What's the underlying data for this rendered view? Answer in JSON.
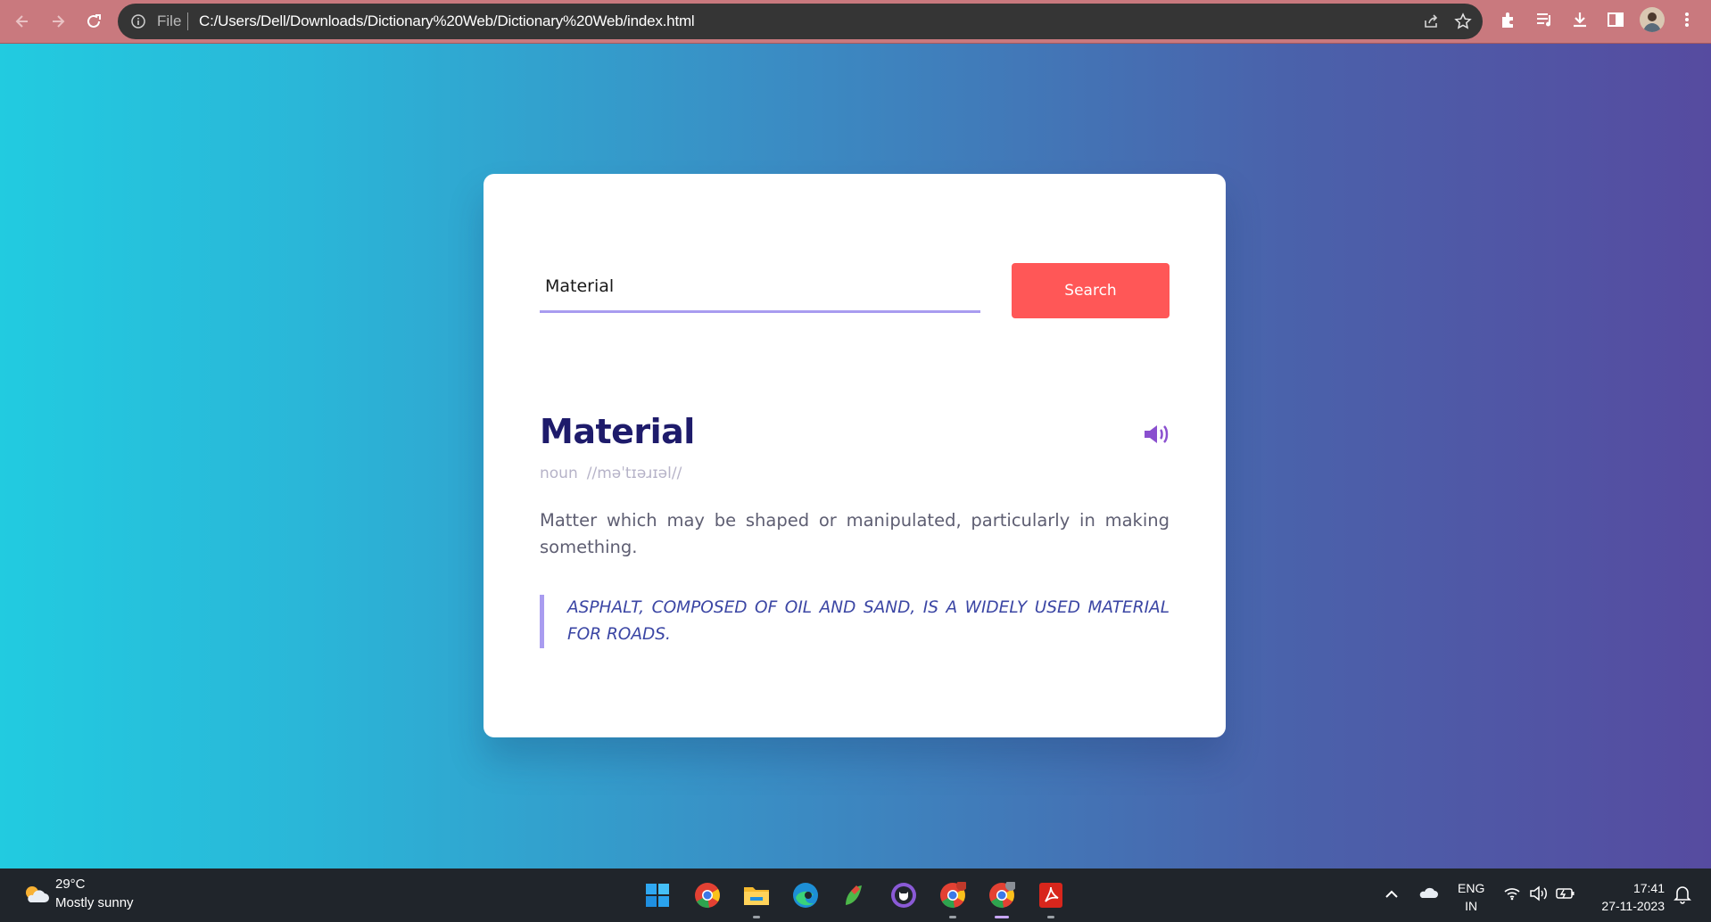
{
  "browser": {
    "file_label": "File",
    "url": "C:/Users/Dell/Downloads/Dictionary%20Web/Dictionary%20Web/index.html"
  },
  "search": {
    "value": "Material",
    "button_label": "Search"
  },
  "result": {
    "word": "Material",
    "part_of_speech": "noun",
    "pronunciation": "//məˈtɪəɹɪəl//",
    "meaning": "Matter which may be shaped or manipulated, particularly in making something.",
    "example": "Asphalt, composed of oil and sand, is a widely used material for roads."
  },
  "taskbar": {
    "weather_temp": "29°C",
    "weather_desc": "Mostly sunny",
    "lang_line1": "ENG",
    "lang_line2": "IN",
    "time": "17:41",
    "date": "27-11-2023"
  },
  "colors": {
    "accent_search": "#ff5757",
    "title": "#1e1b6b",
    "underline": "#a89cf0",
    "example_text": "#3b46a4"
  }
}
